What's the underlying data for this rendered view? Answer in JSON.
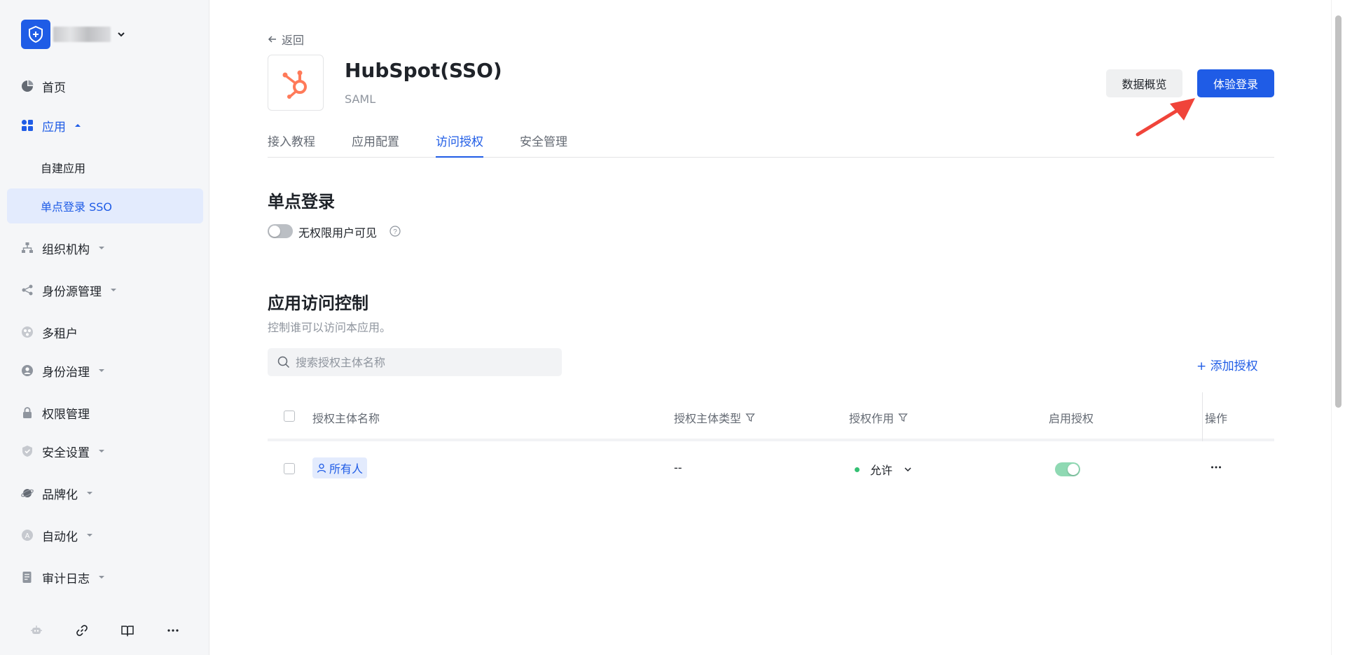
{
  "sidebar": {
    "nav": [
      {
        "label": "首页",
        "icon": "pie-chart-icon"
      },
      {
        "label": "应用",
        "icon": "apps-icon"
      },
      {
        "label": "组织机构",
        "icon": "org-tree-icon"
      },
      {
        "label": "身份源管理",
        "icon": "share-icon"
      },
      {
        "label": "多租户",
        "icon": "tenant-icon"
      },
      {
        "label": "身份治理",
        "icon": "identity-icon"
      },
      {
        "label": "权限管理",
        "icon": "lock-icon"
      },
      {
        "label": "安全设置",
        "icon": "shield-icon"
      },
      {
        "label": "品牌化",
        "icon": "planet-icon"
      },
      {
        "label": "自动化",
        "icon": "automation-icon"
      },
      {
        "label": "审计日志",
        "icon": "log-icon"
      }
    ],
    "sub_items": [
      {
        "label": "自建应用"
      },
      {
        "label": "单点登录 SSO"
      }
    ],
    "footer_icons": [
      "robot-icon",
      "link-icon",
      "book-icon",
      "more-icon"
    ]
  },
  "header": {
    "back_label": "返回",
    "app_name": "HubSpot(SSO)",
    "protocol": "SAML",
    "overview_button": "数据概览",
    "try_login_button": "体验登录"
  },
  "tabs": [
    {
      "label": "接入教程"
    },
    {
      "label": "应用配置"
    },
    {
      "label": "访问授权"
    },
    {
      "label": "安全管理"
    }
  ],
  "sso_section": {
    "title": "单点登录",
    "toggle_label": "无权限用户可见",
    "toggle_on": false
  },
  "access_section": {
    "title": "应用访问控制",
    "description": "控制谁可以访问本应用。",
    "search_placeholder": "搜索授权主体名称",
    "add_label": "添加授权"
  },
  "table": {
    "columns": [
      "授权主体名称",
      "授权主体类型",
      "授权作用",
      "启用授权",
      "操作"
    ],
    "rows": [
      {
        "subject": "所有人",
        "type": "--",
        "effect": "允许",
        "enabled": true
      }
    ]
  },
  "colors": {
    "accent": "#1f5ce6",
    "allow_dot": "#34c073",
    "annotation_arrow": "#f0443a"
  }
}
